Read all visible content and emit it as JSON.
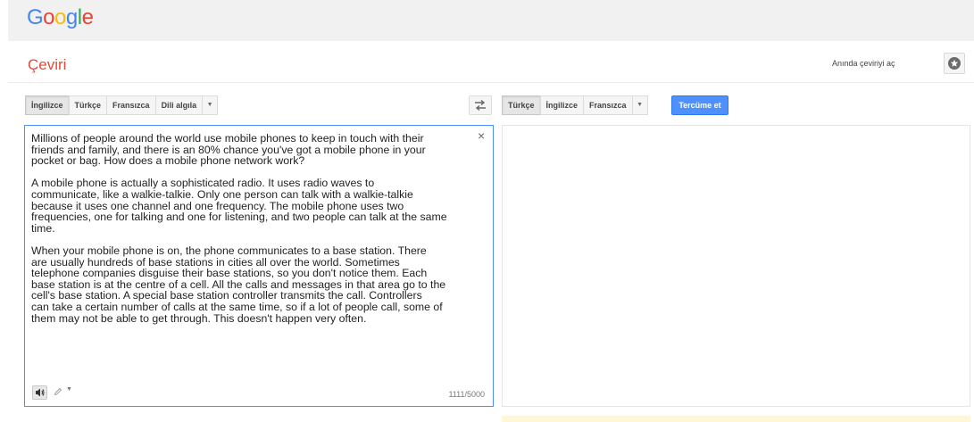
{
  "header": {
    "logo_text": "Google",
    "logo_letters": [
      {
        "ch": "G",
        "color": "#4285f4"
      },
      {
        "ch": "o",
        "color": "#ea4335"
      },
      {
        "ch": "o",
        "color": "#fbbc05"
      },
      {
        "ch": "g",
        "color": "#4285f4"
      },
      {
        "ch": "l",
        "color": "#34a853"
      },
      {
        "ch": "e",
        "color": "#ea4335"
      }
    ]
  },
  "page": {
    "title": "Çeviri",
    "instant_translation_label": "Anında çeviriyi aç",
    "title_color": "#dd4b39"
  },
  "source_languages": {
    "tabs": [
      "İngilizce",
      "Türkçe",
      "Fransızca",
      "Dili algıla"
    ],
    "selected": "İngilizce"
  },
  "target_languages": {
    "tabs": [
      "Türkçe",
      "İngilizce",
      "Fransızca"
    ],
    "selected": "Türkçe"
  },
  "translate_button": {
    "label": "Tercüme et",
    "color": "#4d90fe"
  },
  "source": {
    "text": "Millions of people around the world use mobile phones to keep in touch with their\nfriends and family, and there is an 80% chance you've got a mobile phone in your\npocket or bag. How does a mobile phone network work?\n\nA mobile phone is actually a sophisticated radio. It uses radio waves to\ncommunicate, like a walkie-talkie. Only one person can talk with a walkie-talkie\nbecause it uses one channel and one frequency. The mobile phone uses two\nfrequencies, one for talking and one for listening, and two people can talk at the same\ntime.\n\nWhen your mobile phone is on, the phone communicates to a base station. There\nare usually hundreds of base stations in cities all over the world. Sometimes\ntelephone companies disguise their base stations, so you don't notice them. Each\nbase station is at the centre of a cell. All the calls and messages in that area go to the\ncell's base station. A special base station controller transmits the call. Controllers\ncan take a certain number of calls at the same time, so if a lot of people call, some of\nthem may not be able to get through. This doesn't happen very often.",
    "char_count": "1111/5000",
    "clear_symbol": "×"
  },
  "icons": {
    "swap": "swap-languages-icon",
    "speaker": "speaker-icon",
    "pencil": "pencil-icon",
    "star": "star-icon",
    "dropdown": "chevron-down-icon"
  }
}
